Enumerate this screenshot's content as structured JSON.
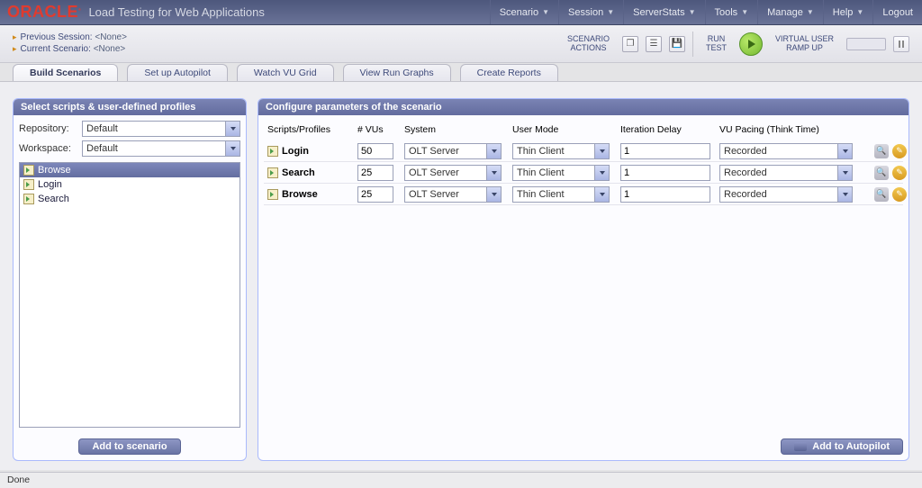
{
  "brand": "ORACLE",
  "brand_sup": "®",
  "app_title": "Load Testing for Web Applications",
  "topnav": [
    {
      "label": "Scenario"
    },
    {
      "label": "Session"
    },
    {
      "label": "ServerStats"
    },
    {
      "label": "Tools"
    },
    {
      "label": "Manage"
    },
    {
      "label": "Help"
    },
    {
      "label": "Logout"
    }
  ],
  "session": {
    "prev_label": "Previous Session:",
    "prev_value": "<None>",
    "curr_label": "Current Scenario:",
    "curr_value": "<None>"
  },
  "toolbar": {
    "scenario_actions_l1": "SCENARIO",
    "scenario_actions_l2": "ACTIONS",
    "run_l1": "RUN",
    "run_l2": "TEST",
    "vu_l1": "VIRTUAL USER",
    "vu_l2": "RAMP UP"
  },
  "tabs": [
    {
      "label": "Build Scenarios",
      "active": true
    },
    {
      "label": "Set up Autopilot"
    },
    {
      "label": "Watch VU Grid"
    },
    {
      "label": "View Run Graphs"
    },
    {
      "label": "Create Reports"
    }
  ],
  "left_panel": {
    "title": "Select scripts & user-defined profiles",
    "repository_label": "Repository:",
    "repository_value": "Default",
    "workspace_label": "Workspace:",
    "workspace_value": "Default",
    "scripts": [
      {
        "name": "Browse",
        "selected": true
      },
      {
        "name": "Login"
      },
      {
        "name": "Search"
      }
    ],
    "add_button": "Add to scenario"
  },
  "right_panel": {
    "title": "Configure parameters of the scenario",
    "columns": {
      "scripts": "Scripts/Profiles",
      "vus": "# VUs",
      "system": "System",
      "usermode": "User Mode",
      "iteration": "Iteration Delay",
      "pacing": "VU Pacing (Think Time)"
    },
    "rows": [
      {
        "name": "Login",
        "vus": "50",
        "system": "OLT Server",
        "usermode": "Thin Client",
        "iteration": "1",
        "pacing": "Recorded"
      },
      {
        "name": "Search",
        "vus": "25",
        "system": "OLT Server",
        "usermode": "Thin Client",
        "iteration": "1",
        "pacing": "Recorded"
      },
      {
        "name": "Browse",
        "vus": "25",
        "system": "OLT Server",
        "usermode": "Thin Client",
        "iteration": "1",
        "pacing": "Recorded"
      }
    ],
    "autopilot_button": "Add to Autopilot"
  },
  "status": "Done"
}
